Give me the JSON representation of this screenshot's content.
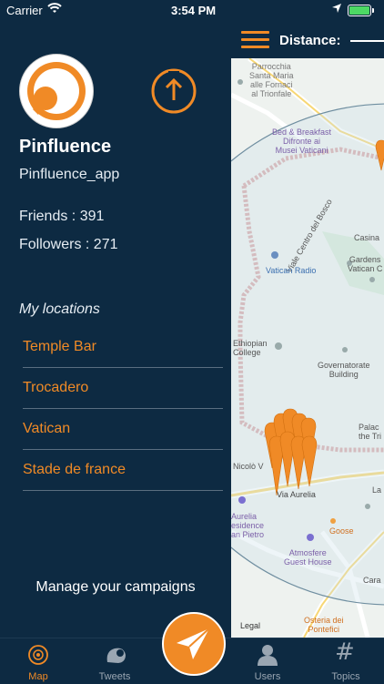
{
  "status": {
    "carrier": "Carrier",
    "time": "3:54 PM"
  },
  "header": {
    "distance_label": "Distance:"
  },
  "profile": {
    "name": "Pinfluence",
    "handle": "Pinfluence_app",
    "friends": "Friends : 391",
    "followers": "Followers : 271"
  },
  "locations": {
    "title": "My locations",
    "items": [
      "Temple Bar",
      "Trocadero",
      "Vatican",
      "Stade de france"
    ]
  },
  "manage_label": "Manage your campaigns",
  "map_labels": {
    "parrocchia": "Parrocchia\nSanta Maria\nalle Fornaci\nal Trionfale",
    "bnb": "Bed & Breakfast\nDifronte ai\nMusei Vaticani",
    "viale": "Viale Centro del Bosco",
    "vatican_radio": "Vatican Radio",
    "casina": "Casina",
    "gardens": "Gardens\nVatican C",
    "ethiopian": "Ethiopian\nCollege",
    "governatorate": "Governatorate\nBuilding",
    "palace": "Palac\nthe Tri",
    "via_aurelia": "Via Aurelia",
    "aurelia_res": "Aurelia\nesidence\nan Pietro",
    "goose": "Goose",
    "atmosfere": "Atmosfere\nGuest House",
    "osteria": "Osteria dei\nPontefici",
    "legal": "Legal",
    "cara": "Cara",
    "nicolo": "Nicolò V",
    "la": "La"
  },
  "tabs": [
    {
      "label": "Map",
      "icon": "map-icon"
    },
    {
      "label": "Tweets",
      "icon": "bird-icon"
    },
    {
      "label": "Users",
      "icon": "user-icon"
    },
    {
      "label": "Topics",
      "icon": "hashtag-icon"
    }
  ],
  "colors": {
    "accent": "#f08a26",
    "sidebar": "#0d2a42",
    "text": "#e6edf3"
  }
}
